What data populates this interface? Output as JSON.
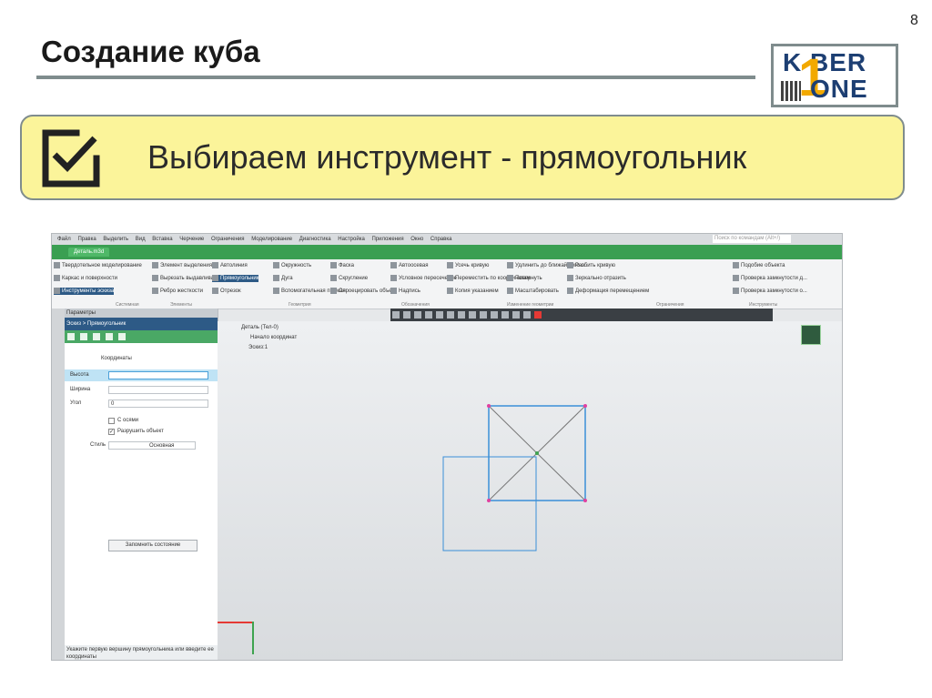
{
  "slide": {
    "number": "8",
    "title": "Создание куба",
    "callout_text": "Выбираем инструмент - прямоугольник"
  },
  "logo": {
    "line1": "K BER",
    "line2": "ONE",
    "digit": "1"
  },
  "colors": {
    "callout_bg": "#fbf49a",
    "app_green": "#3a9f52",
    "selection_blue": "#2d5a86",
    "rect_blue": "#3a8fd8"
  },
  "app": {
    "menu": [
      "Файл",
      "Правка",
      "Выделить",
      "Вид",
      "Вставка",
      "Черчение",
      "Ограничения",
      "Моделирование",
      "Диагностика",
      "Настройка",
      "Приложения",
      "Окно",
      "Справка"
    ],
    "search_placeholder": "Поиск по командам (Alt+/)",
    "document_tab": "Деталь.m3d",
    "ribbon": {
      "left": [
        "Твердотельное моделирование",
        "Каркас и поверхности",
        "Инструменты эскиза"
      ],
      "col2": [
        "Элемент выделения",
        "Вырезать выдавливанием",
        "Ребро жесткости"
      ],
      "geometry": [
        "Автолиния",
        "Окружность",
        "Фаска",
        "Прямоугольник",
        "Дуга",
        "Скругление",
        "Отрезок",
        "Вспомогательная прямая",
        "Спроецировать объект"
      ],
      "designations": [
        "Автоосевая",
        "Условное пересечение",
        "Надпись"
      ],
      "edit": [
        "Усечь кривую",
        "Удлинить до ближайшего о...",
        "Разбить кривую",
        "Переместить по координатам",
        "Повернуть",
        "Зеркально отразить",
        "Копия указанием",
        "Масштабировать",
        "Деформация перемещением"
      ],
      "tools": [
        "Подобие объекта",
        "Проверка замкнутости д...",
        "Проверка замкнутости о..."
      ],
      "groups": [
        "Системная",
        "Элементы",
        "Геометрия",
        "Обозначения",
        "Изменение геометрии",
        "Ограничения",
        "Инструменты"
      ]
    },
    "panel": {
      "header": "Параметры",
      "subheader": "Эскиз > Прямоугольник",
      "section": "Координаты",
      "height_label": "Высота",
      "width_label": "Ширина",
      "angle_label": "Угол",
      "angle_value": "0",
      "axes_label": "С осями",
      "axes_checked": false,
      "destroy_label": "Разрушить объект",
      "destroy_checked": true,
      "style_label": "Стиль",
      "style_value": "Основная",
      "save_state": "Запомнить состояние",
      "hint": "Укажите первую вершину прямоугольника или введите ее координаты"
    },
    "tree": {
      "root": "Деталь (Тел-0)",
      "origin": "Начало координат",
      "sketch": "Эскиз:1"
    }
  }
}
